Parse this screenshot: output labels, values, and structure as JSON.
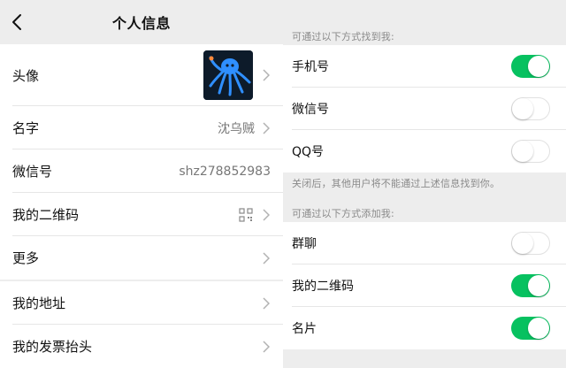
{
  "left": {
    "nav": {
      "title": "个人信息"
    },
    "profile_rows": [
      {
        "label": "头像"
      },
      {
        "label": "名字",
        "value": "沈乌贼"
      },
      {
        "label": "微信号",
        "value": "shz278852983"
      },
      {
        "label": "我的二维码"
      },
      {
        "label": "更多"
      }
    ],
    "extra_rows": [
      {
        "label": "我的地址"
      },
      {
        "label": "我的发票抬头"
      }
    ]
  },
  "right": {
    "find_header": "可通过以下方式找到我:",
    "find_rows": [
      {
        "label": "手机号",
        "enabled": true
      },
      {
        "label": "微信号",
        "enabled": false
      },
      {
        "label": "QQ号",
        "enabled": false
      }
    ],
    "find_note": "关闭后，其他用户将不能通过上述信息找到你。",
    "add_header": "可通过以下方式添加我:",
    "add_rows": [
      {
        "label": "群聊",
        "enabled": false
      },
      {
        "label": "我的二维码",
        "enabled": true
      },
      {
        "label": "名片",
        "enabled": true
      }
    ]
  },
  "colors": {
    "toggle_on": "#07c160",
    "background": "#ededed",
    "accent_icon": "#3aa0ff"
  }
}
